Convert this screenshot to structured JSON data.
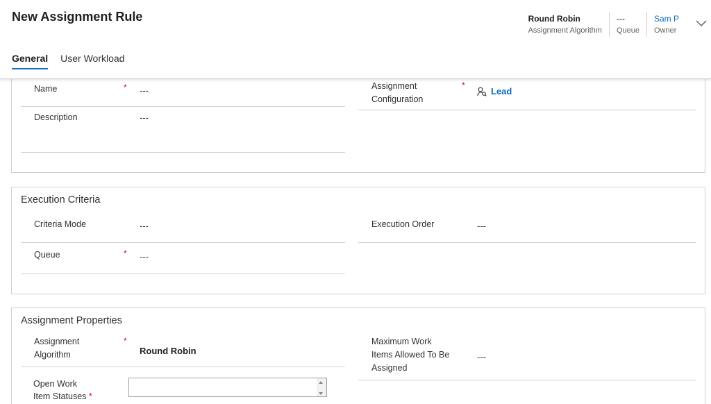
{
  "header": {
    "title": "New Assignment Rule",
    "fields": [
      {
        "value": "Round Robin",
        "label": "Assignment Algorithm"
      },
      {
        "value": "---",
        "label": "Queue"
      },
      {
        "value": "Sam P",
        "label": "Owner"
      }
    ],
    "expand_icon": "chevron-down-icon"
  },
  "tabs": [
    {
      "label": "General",
      "active": true
    },
    {
      "label": "User Workload",
      "active": false
    }
  ],
  "general": {
    "name": {
      "label": "Name",
      "required": "*",
      "value": "---"
    },
    "description": {
      "label": "Description",
      "value": "---"
    },
    "assignment_configuration": {
      "label_line1": "Assignment",
      "label_line2": "Configuration",
      "required": "*",
      "value": "Lead",
      "icon": "lookup-record-icon"
    }
  },
  "execution_criteria": {
    "title": "Execution Criteria",
    "criteria_mode": {
      "label": "Criteria Mode",
      "value": "---"
    },
    "execution_order": {
      "label": "Execution Order",
      "value": "---"
    },
    "queue": {
      "label": "Queue",
      "required": "*",
      "value": "---"
    }
  },
  "assignment_properties": {
    "title": "Assignment Properties",
    "assignment_algorithm": {
      "label_line1": "Assignment",
      "label_line2": "Algorithm",
      "required": "*",
      "value": "Round Robin"
    },
    "max_work_items": {
      "label_line1": "Maximum Work",
      "label_line2": "Items Allowed To Be",
      "label_line3": "Assigned",
      "value": "---"
    },
    "open_work_item_statuses": {
      "label_line1": "Open Work",
      "label_line2": "Item Statuses",
      "required": "*"
    }
  },
  "colors": {
    "accent": "#0f6cbd",
    "required": "#c50f1f",
    "border": "#d2d0ce"
  }
}
